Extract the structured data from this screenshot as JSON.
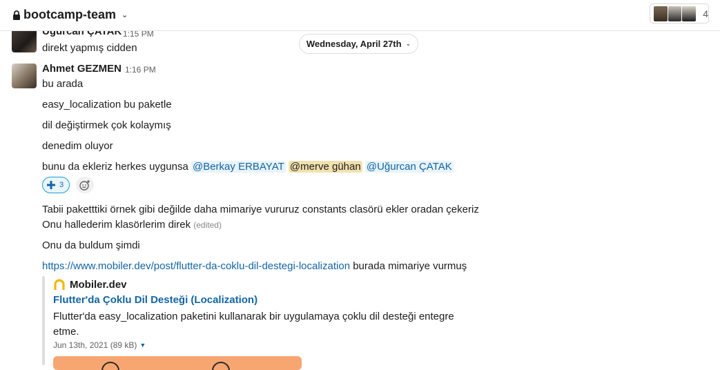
{
  "header": {
    "channel_name": "bootcamp-team",
    "member_count": "4",
    "colors": {
      "border": "#e2e2e2"
    }
  },
  "date_divider": {
    "label": "Wednesday, April 27th"
  },
  "messages": [
    {
      "author": "Uğurcan ÇATAK",
      "time": "1:15 PM",
      "lines": [
        "direkt yapmış cidden"
      ]
    },
    {
      "author": "Ahmet GEZMEN",
      "time": "1:16 PM",
      "lines": [
        "bu arada",
        "easy_localization bu paketle",
        "dil değiştirmek çok kolaymış",
        "denedim oluyor"
      ],
      "mention_line": {
        "text": "bunu da ekleriz herkes uygunsa",
        "mentions": [
          "@Berkay ERBAYAT",
          "@merve gühan",
          "@Uğurcan ÇATAK"
        ]
      },
      "reaction": {
        "emoji": "heavy-plus-icon",
        "count": "3"
      },
      "more_lines": {
        "l1": "Tabii paketttiki örnek gibi değilde daha mimariye vururuz constants clasörü ekler oradan çekeriz",
        "l2": "Onu hallederim klasörlerim direk",
        "edited": "(edited)",
        "l3": "Onu da buldum şimdi",
        "url": "https://www.mobiler.dev/post/flutter-da-coklu-dil-destegi-localization",
        "after_url": " burada mimariye vurmuş"
      }
    }
  ],
  "unfurl": {
    "site": "Mobiler.dev",
    "title": "Flutter'da Çoklu Dil Desteği (Localization)",
    "description": "Flutter'da easy_localization paketini kullanarak bir uygulamaya çoklu dil desteği entegre etme.",
    "meta": "Jun 13th, 2021 (89 kB)",
    "colors": {
      "preview_bg": "#f7a672",
      "logo": "#f2b705"
    }
  }
}
